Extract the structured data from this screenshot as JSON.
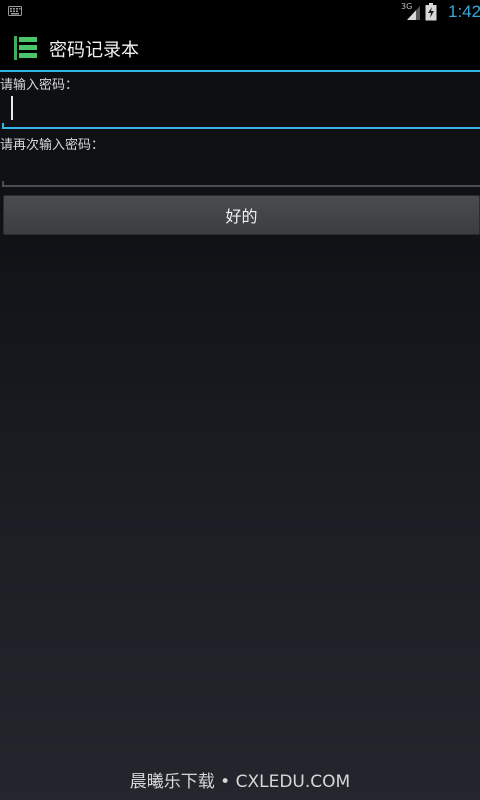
{
  "status_bar": {
    "time": "1:42",
    "network_label": "3G",
    "icons": [
      "keyboard-icon",
      "signal-icon",
      "battery-charging-icon"
    ],
    "accent_color": "#36a8d8"
  },
  "action_bar": {
    "title": "密码记录本",
    "icon": "notebook-app-icon",
    "icon_color": "#3fae5c",
    "divider_color": "#33b5e5"
  },
  "form": {
    "password_label": "请输入密码：",
    "password_value": "",
    "confirm_label": "请再次输入密码：",
    "confirm_value": "",
    "focused_underline_color": "#33b5e5",
    "idle_underline_color": "#4a4d52"
  },
  "actions": {
    "ok_label": "好的"
  },
  "watermark": {
    "text": "晨曦乐下载 • CXLEDU.COM"
  }
}
